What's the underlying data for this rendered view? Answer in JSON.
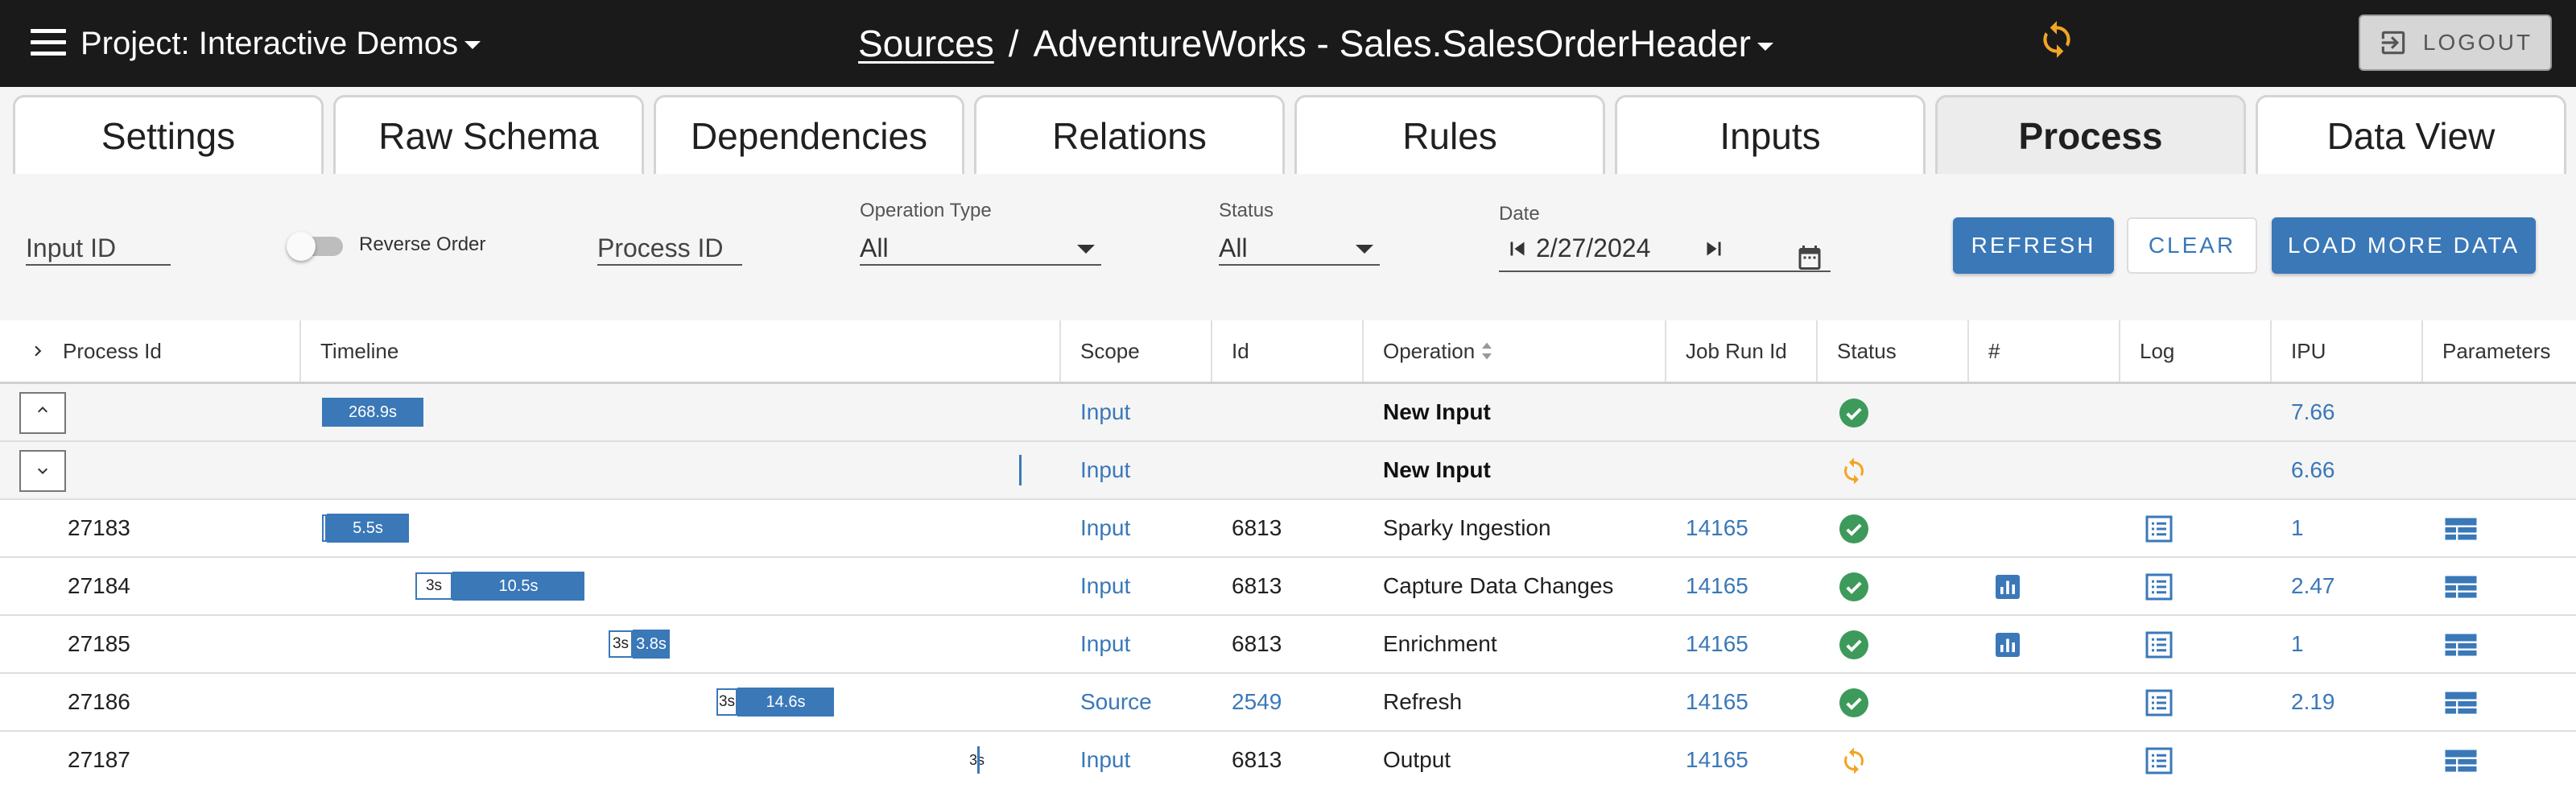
{
  "header": {
    "project_label": "Project:",
    "project_name": "Interactive Demos",
    "breadcrumb_root": "Sources",
    "breadcrumb_sep": "/",
    "source_name": "AdventureWorks - Sales.SalesOrderHeader",
    "logout_label": "LOGOUT"
  },
  "tabs": [
    "Settings",
    "Raw Schema",
    "Dependencies",
    "Relations",
    "Rules",
    "Inputs",
    "Process",
    "Data View"
  ],
  "active_tab": "Process",
  "filters": {
    "input_id_placeholder": "Input ID",
    "reverse_order_label": "Reverse Order",
    "process_id_placeholder": "Process ID",
    "operation_type_label": "Operation Type",
    "operation_type_value": "All",
    "status_label": "Status",
    "status_value": "All",
    "date_label": "Date",
    "date_value": "2/27/2024",
    "refresh_label": "REFRESH",
    "clear_label": "CLEAR",
    "load_more_label": "LOAD MORE DATA"
  },
  "columns": {
    "process_id": "Process Id",
    "timeline": "Timeline",
    "scope": "Scope",
    "id": "Id",
    "operation": "Operation",
    "job_run_id": "Job Run Id",
    "status": "Status",
    "count": "#",
    "log": "Log",
    "ipu": "IPU",
    "parameters": "Parameters"
  },
  "colors": {
    "accent": "#3a78b8",
    "success": "#3d9a5b",
    "running": "#f2a524",
    "topbar": "#1a1a1a"
  },
  "rows": [
    {
      "group": true,
      "expand": "up",
      "process_id": "",
      "bar_label": "268.9s",
      "scope": "Input",
      "id": "",
      "operation": "New Input",
      "job_run_id": "",
      "status": "success",
      "chart": false,
      "log": false,
      "ipu": "7.66",
      "params": false
    },
    {
      "group": true,
      "expand": "down",
      "process_id": "",
      "bar_label": "",
      "scope": "Input",
      "id": "",
      "operation": "New Input",
      "job_run_id": "",
      "status": "running",
      "chart": false,
      "log": false,
      "ipu": "6.66",
      "params": false
    },
    {
      "group": false,
      "process_id": "27183",
      "wait_label": "",
      "bar_label": "5.5s",
      "scope": "Input",
      "id": "6813",
      "operation": "Sparky Ingestion",
      "job_run_id": "14165",
      "status": "success",
      "chart": false,
      "log": true,
      "ipu": "1",
      "params": true
    },
    {
      "group": false,
      "process_id": "27184",
      "wait_label": "3s",
      "bar_label": "10.5s",
      "scope": "Input",
      "id": "6813",
      "operation": "Capture Data Changes",
      "job_run_id": "14165",
      "status": "success",
      "chart": true,
      "log": true,
      "ipu": "2.47",
      "params": true
    },
    {
      "group": false,
      "process_id": "27185",
      "wait_label": "3s",
      "bar_label": "3.8s",
      "scope": "Input",
      "id": "6813",
      "operation": "Enrichment",
      "job_run_id": "14165",
      "status": "success",
      "chart": true,
      "log": true,
      "ipu": "1",
      "params": true
    },
    {
      "group": false,
      "process_id": "27186",
      "wait_label": "3s",
      "bar_label": "14.6s",
      "scope": "Source",
      "id": "2549",
      "operation": "Refresh",
      "job_run_id": "14165",
      "status": "success",
      "chart": false,
      "log": true,
      "ipu": "2.19",
      "params": true
    },
    {
      "group": false,
      "process_id": "27187",
      "wait_label": "3s",
      "bar_label": "",
      "scope": "Input",
      "id": "6813",
      "operation": "Output",
      "job_run_id": "14165",
      "status": "running",
      "chart": false,
      "log": true,
      "ipu": "",
      "params": true
    }
  ]
}
